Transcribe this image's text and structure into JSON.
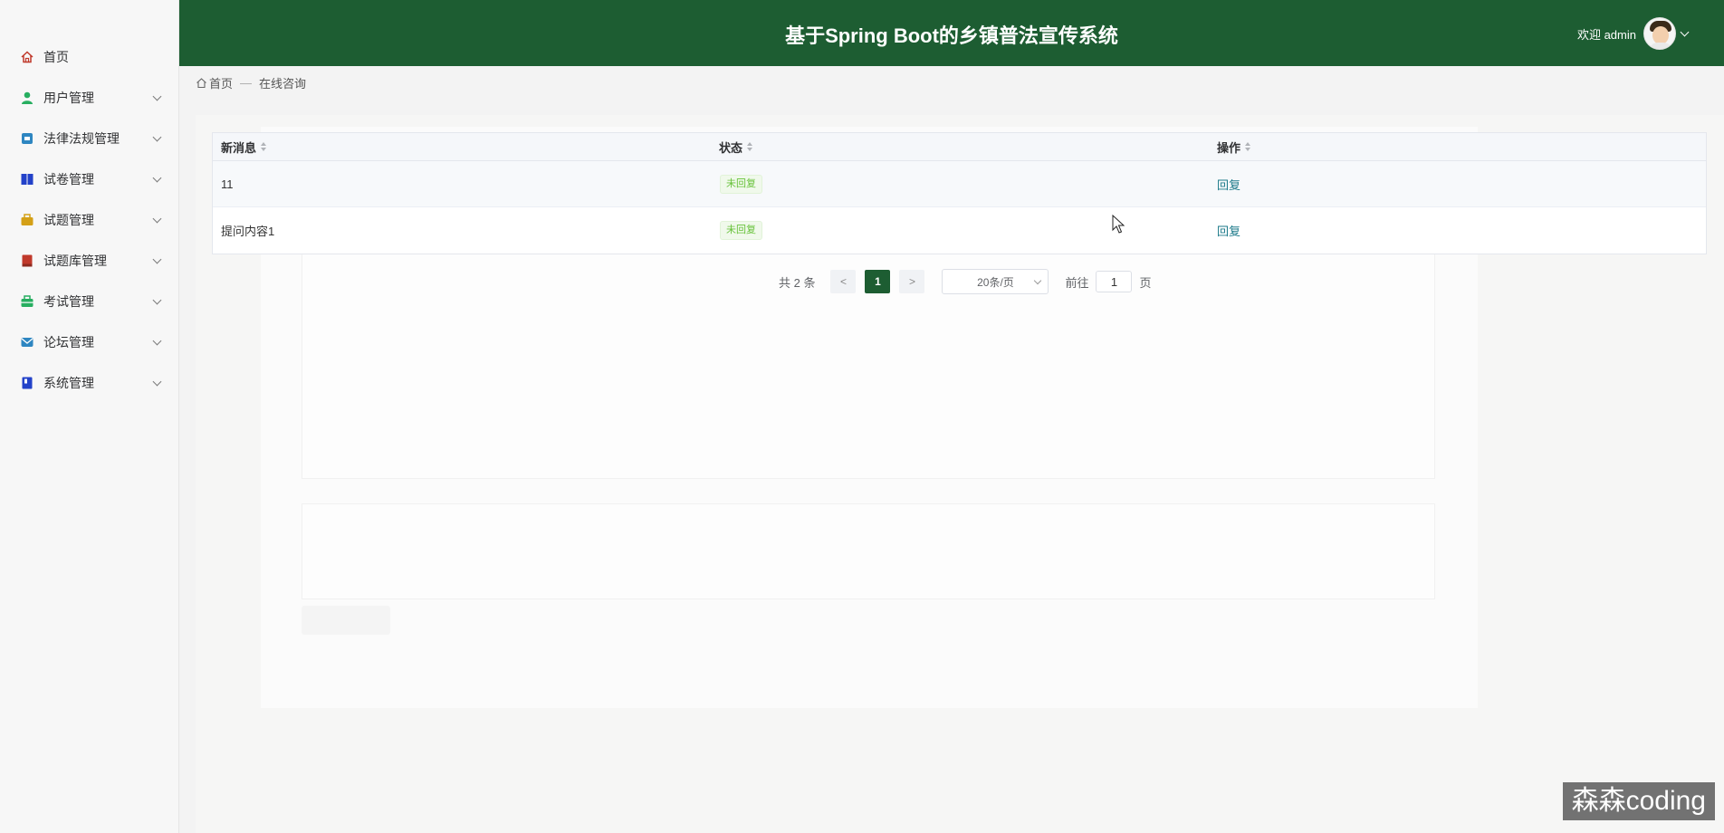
{
  "app": {
    "title": "基于Spring Boot的乡镇普法宣传系统",
    "welcome": "欢迎 admin"
  },
  "sidebar": {
    "items": [
      {
        "label": "首页",
        "icon": "home-icon",
        "color": "#c0392b",
        "expandable": false
      },
      {
        "label": "用户管理",
        "icon": "user-icon",
        "color": "#27ae60",
        "expandable": true
      },
      {
        "label": "法律法规管理",
        "icon": "law-icon",
        "color": "#2e86c1",
        "expandable": true
      },
      {
        "label": "试卷管理",
        "icon": "paper-icon",
        "color": "#2342c9",
        "expandable": true
      },
      {
        "label": "试题管理",
        "icon": "question-icon",
        "color": "#d4a017",
        "expandable": true
      },
      {
        "label": "试题库管理",
        "icon": "bank-icon",
        "color": "#c0392b",
        "expandable": true
      },
      {
        "label": "考试管理",
        "icon": "exam-icon",
        "color": "#27ae60",
        "expandable": true
      },
      {
        "label": "论坛管理",
        "icon": "forum-icon",
        "color": "#2e86c1",
        "expandable": true
      },
      {
        "label": "系统管理",
        "icon": "system-icon",
        "color": "#2342c9",
        "expandable": true
      }
    ]
  },
  "breadcrumb": {
    "home": "首页",
    "separator": "—",
    "current": "在线咨询"
  },
  "table": {
    "columns": [
      "新消息",
      "状态",
      "操作"
    ],
    "rows": [
      {
        "message": "11",
        "status": "未回复",
        "action": "回复"
      },
      {
        "message": "提问内容1",
        "status": "未回复",
        "action": "回复"
      }
    ]
  },
  "pagination": {
    "total": "共 2 条",
    "prev": "<",
    "current_page": "1",
    "next": ">",
    "page_size": "20条/页",
    "goto_prefix": "前往",
    "goto_value": "1",
    "goto_suffix": "页"
  },
  "watermark": "森森coding",
  "colors": {
    "header_bg": "#1d5d32",
    "accent": "#1d5d32",
    "status_tag": "#67c23a",
    "link": "#1d7a8a"
  }
}
